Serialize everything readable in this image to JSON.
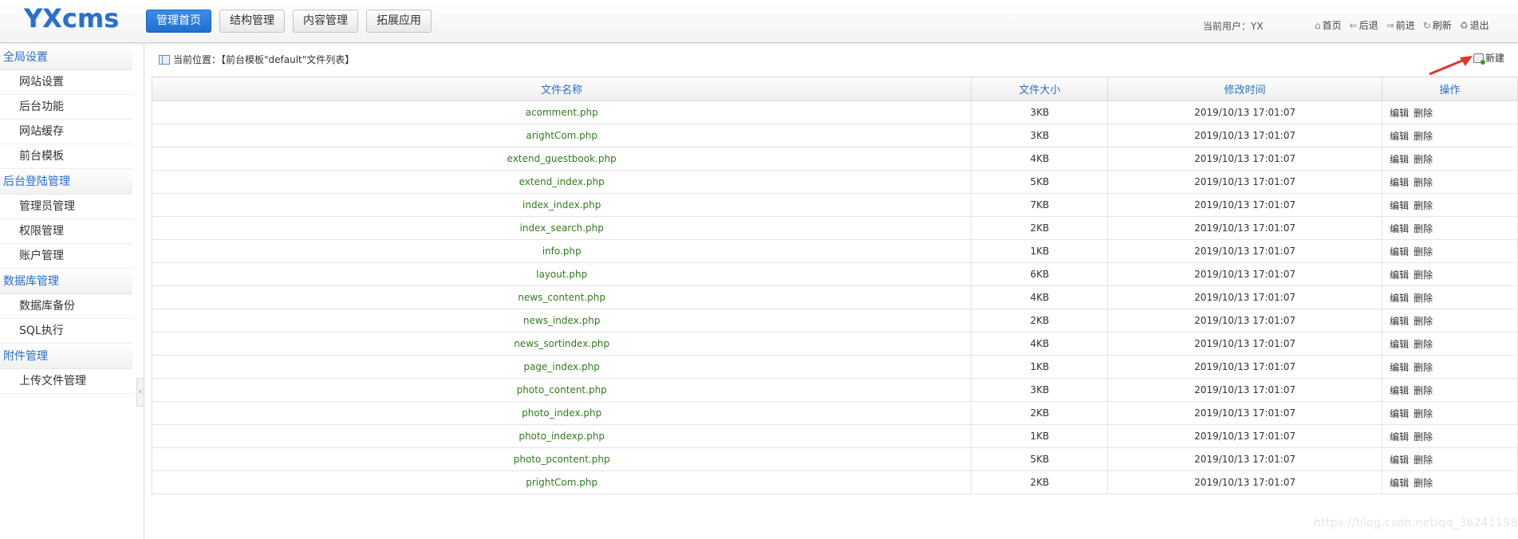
{
  "header": {
    "logo": "YXcms",
    "nav": [
      "管理首页",
      "结构管理",
      "内容管理",
      "拓展应用"
    ],
    "user_info": "当前用户：YX",
    "quick_links": [
      {
        "label": "首页",
        "icon": "home-icon",
        "glyph": "⌂"
      },
      {
        "label": "后退",
        "icon": "back-arrow-icon",
        "glyph": "⇐"
      },
      {
        "label": "前进",
        "icon": "forward-arrow-icon",
        "glyph": "⇒"
      },
      {
        "label": "刷新",
        "icon": "refresh-icon",
        "glyph": "↻"
      },
      {
        "label": "退出",
        "icon": "logout-icon",
        "glyph": "♻"
      }
    ]
  },
  "sidebar": {
    "sections": [
      {
        "title": "全局设置",
        "items": [
          "网站设置",
          "后台功能",
          "网站缓存",
          "前台模板"
        ]
      },
      {
        "title": "后台登陆管理",
        "items": [
          "管理员管理",
          "权限管理",
          "账户管理"
        ]
      },
      {
        "title": "数据库管理",
        "items": [
          "数据库备份",
          "SQL执行"
        ]
      },
      {
        "title": "附件管理",
        "items": [
          "上传文件管理"
        ]
      }
    ]
  },
  "breadcrumb": "当前位置：【前台模板\"default\"文件列表】",
  "new_button": "新建",
  "table": {
    "headers": [
      "文件名称",
      "文件大小",
      "修改时间",
      "操作"
    ],
    "rows": [
      {
        "name": "acomment.php",
        "size": "3KB",
        "time": "2019/10/13 17:01:07"
      },
      {
        "name": "arightCom.php",
        "size": "3KB",
        "time": "2019/10/13 17:01:07"
      },
      {
        "name": "extend_guestbook.php",
        "size": "4KB",
        "time": "2019/10/13 17:01:07"
      },
      {
        "name": "extend_index.php",
        "size": "5KB",
        "time": "2019/10/13 17:01:07"
      },
      {
        "name": "index_index.php",
        "size": "7KB",
        "time": "2019/10/13 17:01:07"
      },
      {
        "name": "index_search.php",
        "size": "2KB",
        "time": "2019/10/13 17:01:07"
      },
      {
        "name": "info.php",
        "size": "1KB",
        "time": "2019/10/13 17:01:07"
      },
      {
        "name": "layout.php",
        "size": "6KB",
        "time": "2019/10/13 17:01:07"
      },
      {
        "name": "news_content.php",
        "size": "4KB",
        "time": "2019/10/13 17:01:07"
      },
      {
        "name": "news_index.php",
        "size": "2KB",
        "time": "2019/10/13 17:01:07"
      },
      {
        "name": "news_sortindex.php",
        "size": "4KB",
        "time": "2019/10/13 17:01:07"
      },
      {
        "name": "page_index.php",
        "size": "1KB",
        "time": "2019/10/13 17:01:07"
      },
      {
        "name": "photo_content.php",
        "size": "3KB",
        "time": "2019/10/13 17:01:07"
      },
      {
        "name": "photo_index.php",
        "size": "2KB",
        "time": "2019/10/13 17:01:07"
      },
      {
        "name": "photo_indexp.php",
        "size": "1KB",
        "time": "2019/10/13 17:01:07"
      },
      {
        "name": "photo_pcontent.php",
        "size": "5KB",
        "time": "2019/10/13 17:01:07"
      },
      {
        "name": "prightCom.php",
        "size": "2KB",
        "time": "2019/10/13 17:01:07"
      }
    ],
    "edit_label": "编辑",
    "delete_label": "删除"
  },
  "watermark": "https://blog.csdn.net/qq_36241198",
  "colors": {
    "accent": "#2a6fcb",
    "filename": "#2e7d1c",
    "arrow": "#e0352b"
  }
}
